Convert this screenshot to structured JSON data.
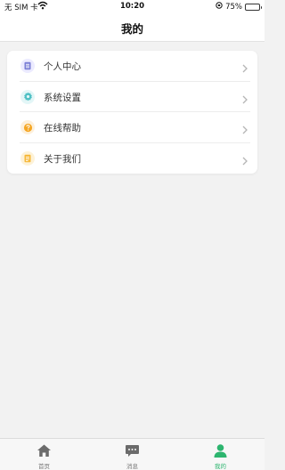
{
  "status_bar": {
    "carrier": "无 SIM 卡",
    "time": "10:20",
    "battery_percent": "75%",
    "battery_level": 0.75
  },
  "nav": {
    "title": "我的"
  },
  "menu": {
    "items": [
      {
        "label": "个人中心",
        "icon": "profile-card-icon",
        "color": "#7b7fd6",
        "bg": "#ecebff"
      },
      {
        "label": "系统设置",
        "icon": "gear-icon",
        "color": "#4ec0c4",
        "bg": "#e3f6f7"
      },
      {
        "label": "在线帮助",
        "icon": "help-icon",
        "color": "#f5a623",
        "bg": "#fdf0db"
      },
      {
        "label": "关于我们",
        "icon": "info-doc-icon",
        "color": "#f6b93b",
        "bg": "#fdf2d8"
      }
    ]
  },
  "tab_bar": {
    "tabs": [
      {
        "label": "首页",
        "icon": "home-icon",
        "active": false
      },
      {
        "label": "消息",
        "icon": "message-icon",
        "active": false
      },
      {
        "label": "我的",
        "icon": "user-icon",
        "active": true
      }
    ],
    "active_color": "#2db56f",
    "inactive_color": "#777777"
  }
}
